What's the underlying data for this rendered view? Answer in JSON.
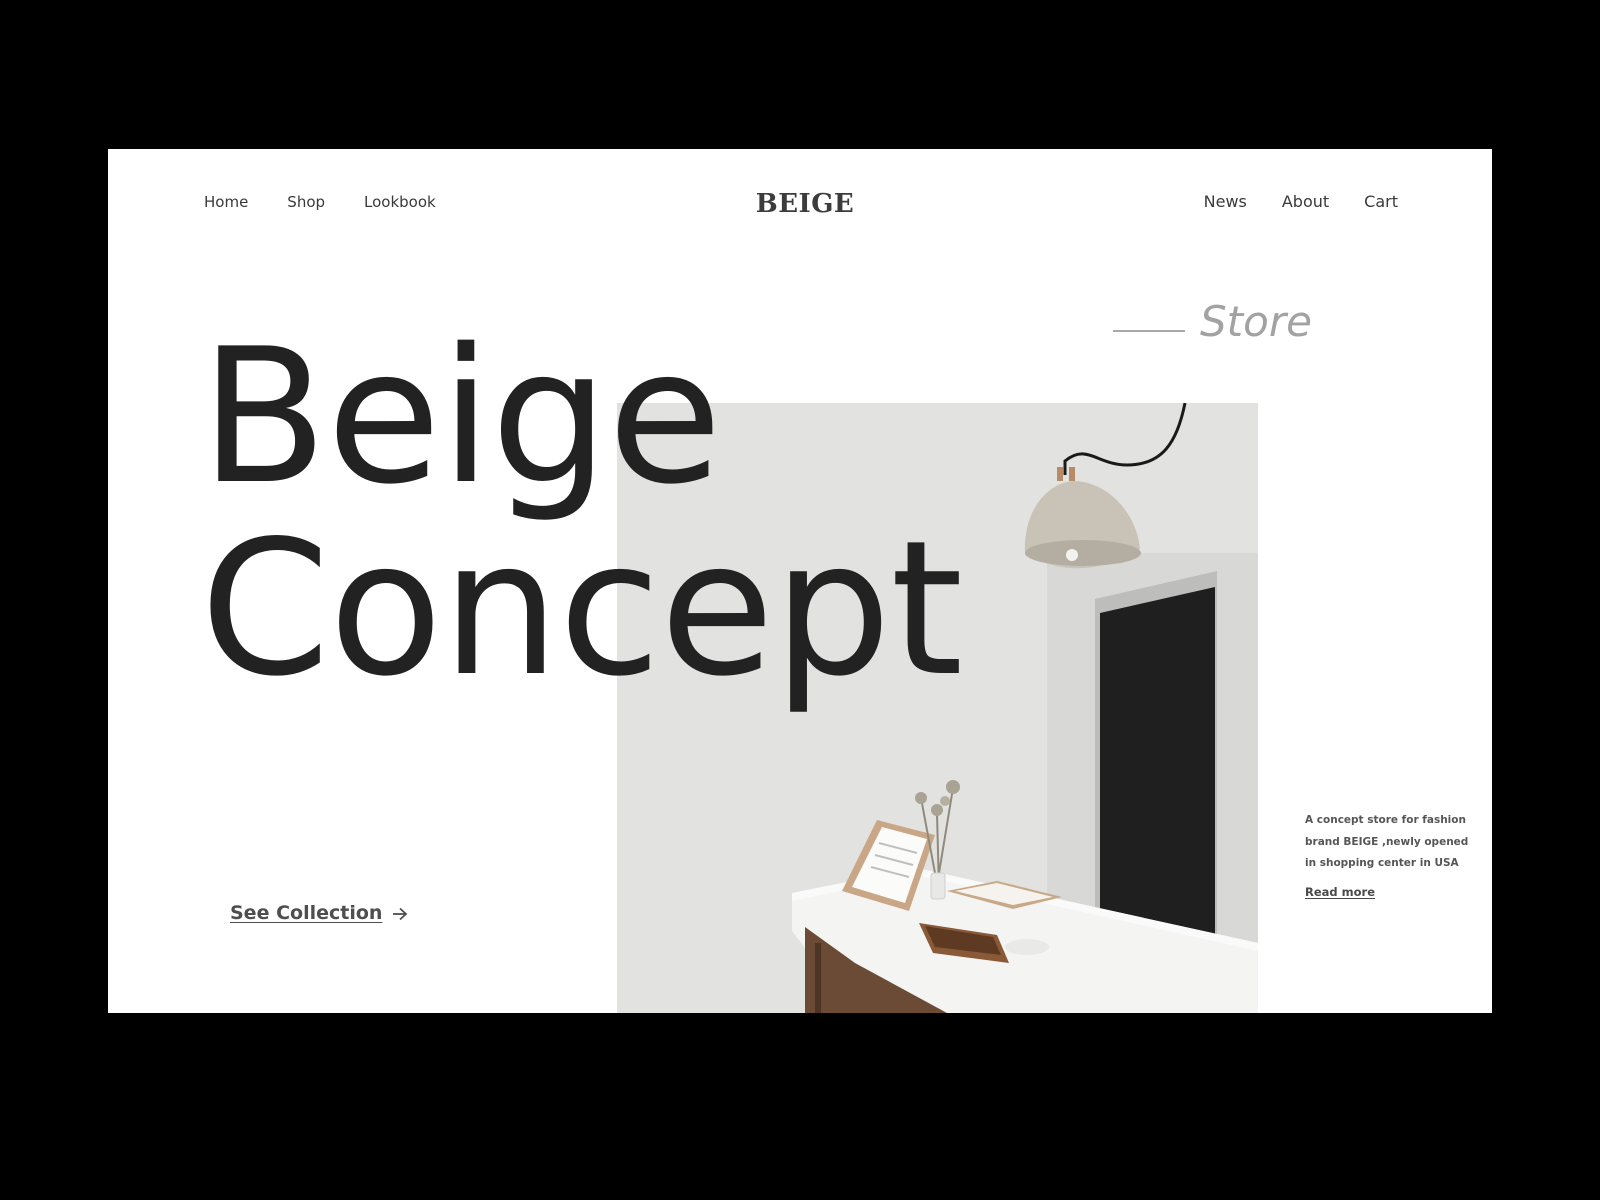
{
  "nav": {
    "left": [
      {
        "label": "Home"
      },
      {
        "label": "Shop"
      },
      {
        "label": "Lookbook"
      }
    ],
    "brand": "BEIGE",
    "right": [
      {
        "label": "News"
      },
      {
        "label": "About"
      },
      {
        "label": "Cart"
      }
    ]
  },
  "hero": {
    "eyebrow": "Store",
    "line1": "Beige",
    "line2": "Concept",
    "cta_label": "See Collection",
    "cta_icon": "arrow-right-icon"
  },
  "aside": {
    "description": "A concept store for fashion brand BEIGE ,newly opened in shopping center in USA",
    "read_more": "Read more"
  },
  "colors": {
    "page_background": "#000000",
    "panel_background": "#ffffff",
    "headline": "#222222",
    "muted": "#a2a2a2"
  }
}
